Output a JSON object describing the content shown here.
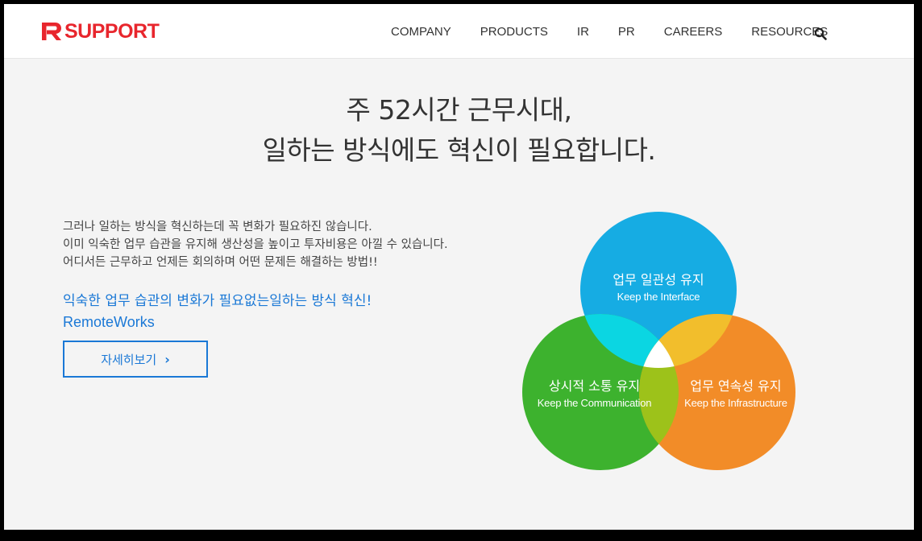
{
  "brand": {
    "name": "SUPPORT",
    "color": "#e8262d"
  },
  "nav": {
    "items": [
      {
        "label": "COMPANY"
      },
      {
        "label": "PRODUCTS"
      },
      {
        "label": "IR"
      },
      {
        "label": "PR"
      },
      {
        "label": "CAREERS"
      },
      {
        "label": "RESOURCES"
      }
    ],
    "search_icon": "search-icon"
  },
  "hero": {
    "line1": "주 52시간 근무시대,",
    "line2": "일하는 방식에도 혁신이 필요합니다."
  },
  "intro": {
    "lines": [
      "그러나 일하는 방식을 혁신하는데 꼭 변화가 필요하진 않습니다.",
      "이미 익숙한 업무 습관을 유지해 생산성을 높이고 투자비용은 아낄 수 있습니다.",
      "어디서든 근무하고 언제든 회의하며 어떤 문제든 해결하는 방법!!"
    ],
    "accent": "익숙한 업무 습관의 변화가 필요없는일하는 방식 혁신!",
    "product": "RemoteWorks",
    "button_label": "자세히보기",
    "accent_color": "#1a78d6"
  },
  "venn": {
    "top": {
      "ko": "업무 일관성 유지",
      "en": "Keep the Interface",
      "color": "#16ace3"
    },
    "left": {
      "ko": "상시적 소통 유지",
      "en": "Keep the Communication",
      "color": "#3db22e"
    },
    "right": {
      "ko": "업무 연속성 유지",
      "en": "Keep the Infrastructure",
      "color": "#f28c28"
    }
  }
}
